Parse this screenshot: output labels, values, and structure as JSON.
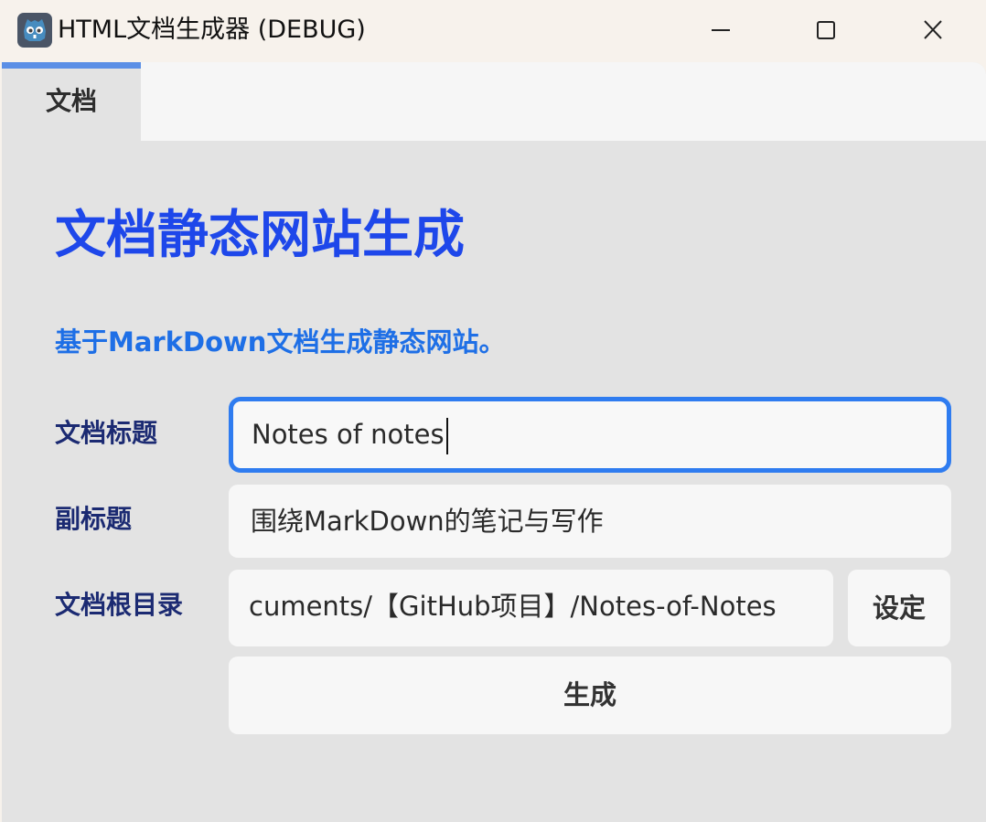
{
  "window": {
    "title": "HTML文档生成器 (DEBUG)",
    "icon": "godot-icon",
    "controls": [
      "minimize-icon",
      "maximize-icon",
      "close-icon"
    ]
  },
  "tabs": [
    {
      "label": "文档",
      "active": true
    }
  ],
  "page": {
    "title": "文档静态网站生成",
    "subtitle": "基于MarkDown文档生成静态网站。"
  },
  "form": {
    "doc_title_label": "文档标题",
    "doc_title_value": "Notes of notes",
    "subtitle_label": "副标题",
    "subtitle_value": "围绕MarkDown的笔记与写作",
    "root_label": "文档根目录",
    "root_value": "cuments/【GitHub项目】/Notes-of-Notes",
    "set_button": "设定",
    "generate_button": "生成"
  },
  "colors": {
    "accent": "#2f7cf0",
    "title": "#1e47ea",
    "subtitle": "#1e6fe6",
    "label": "#1b2a72",
    "tab_indicator": "#5b8fe6"
  }
}
